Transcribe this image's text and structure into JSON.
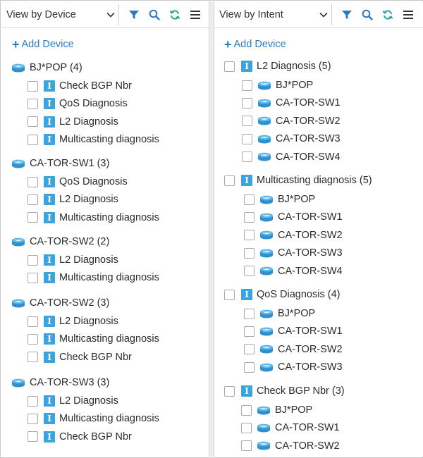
{
  "left_panel": {
    "view_label": "View by Device",
    "add_device_label": "Add Device",
    "groups": [
      {
        "name": "BJ*POP (4)",
        "children": [
          "Check BGP Nbr",
          "QoS Diagnosis",
          "L2 Diagnosis",
          "Multicasting diagnosis"
        ]
      },
      {
        "name": "CA-TOR-SW1 (3)",
        "children": [
          "QoS Diagnosis",
          "L2 Diagnosis",
          "Multicasting diagnosis"
        ]
      },
      {
        "name": "CA-TOR-SW2 (2)",
        "children": [
          "L2 Diagnosis",
          "Multicasting diagnosis"
        ]
      },
      {
        "name": "CA-TOR-SW2 (3)",
        "children": [
          "L2 Diagnosis",
          "Multicasting diagnosis",
          "Check BGP Nbr"
        ]
      },
      {
        "name": "CA-TOR-SW3 (3)",
        "children": [
          "L2 Diagnosis",
          "Multicasting diagnosis",
          "Check BGP Nbr"
        ]
      }
    ]
  },
  "right_panel": {
    "view_label": "View by Intent",
    "add_device_label": "Add Device",
    "groups": [
      {
        "name": "L2 Diagnosis (5)",
        "children": [
          "BJ*POP",
          "CA-TOR-SW1",
          "CA-TOR-SW2",
          "CA-TOR-SW3",
          "CA-TOR-SW4"
        ]
      },
      {
        "name": "Multicasting diagnosis (5)",
        "children": [
          "BJ*POP",
          "CA-TOR-SW1",
          "CA-TOR-SW2",
          "CA-TOR-SW3",
          "CA-TOR-SW4"
        ]
      },
      {
        "name": "QoS Diagnosis (4)",
        "children": [
          "BJ*POP",
          "CA-TOR-SW1",
          "CA-TOR-SW2",
          "CA-TOR-SW3"
        ]
      },
      {
        "name": "Check BGP Nbr (3)",
        "children": [
          "BJ*POP",
          "CA-TOR-SW1",
          "CA-TOR-SW2"
        ]
      }
    ]
  },
  "icons": {
    "toolbar": [
      "filter-icon",
      "search-icon",
      "refresh-icon",
      "menu-icon"
    ],
    "intent": "intent-icon",
    "device": "router-icon"
  },
  "colors": {
    "accent": "#2b7bbf",
    "intent_badge": "#3aa3e0",
    "device_icon": "#3b9fd8"
  }
}
